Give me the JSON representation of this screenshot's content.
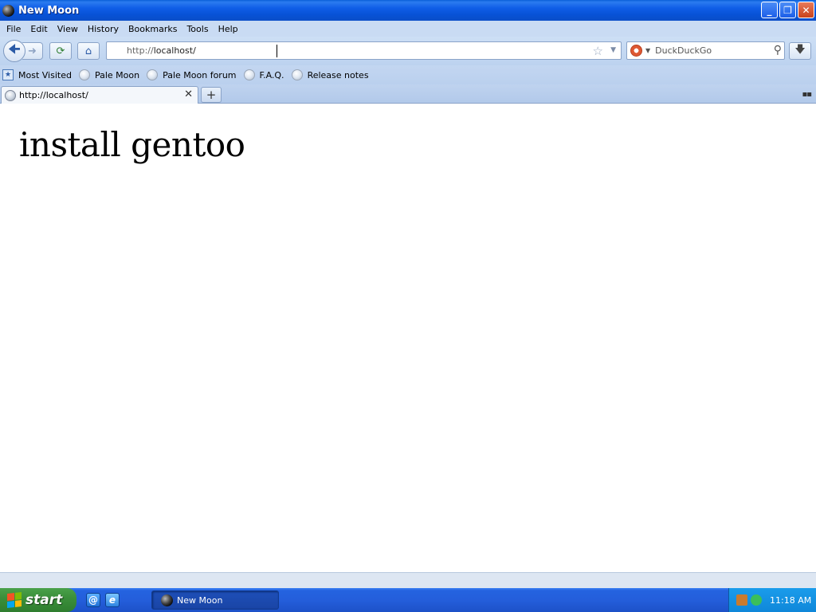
{
  "window": {
    "title": "New Moon",
    "controls": [
      "_",
      "❐",
      "✕"
    ]
  },
  "menu": {
    "items": [
      "File",
      "Edit",
      "View",
      "History",
      "Bookmarks",
      "Tools",
      "Help"
    ]
  },
  "navbar": {
    "url_protocol": "http://",
    "url_host": "localhost/",
    "search_placeholder": "DuckDuckGo"
  },
  "bookmarks": {
    "items": [
      "Most Visited",
      "Pale Moon",
      "Pale Moon forum",
      "F.A.Q.",
      "Release notes"
    ]
  },
  "tabs": {
    "items": [
      {
        "label": "http://localhost/"
      }
    ]
  },
  "content": {
    "heading": "install gentoo"
  },
  "taskbar": {
    "start_label": "start",
    "task_label": "New Moon",
    "clock": "11:18 AM"
  }
}
